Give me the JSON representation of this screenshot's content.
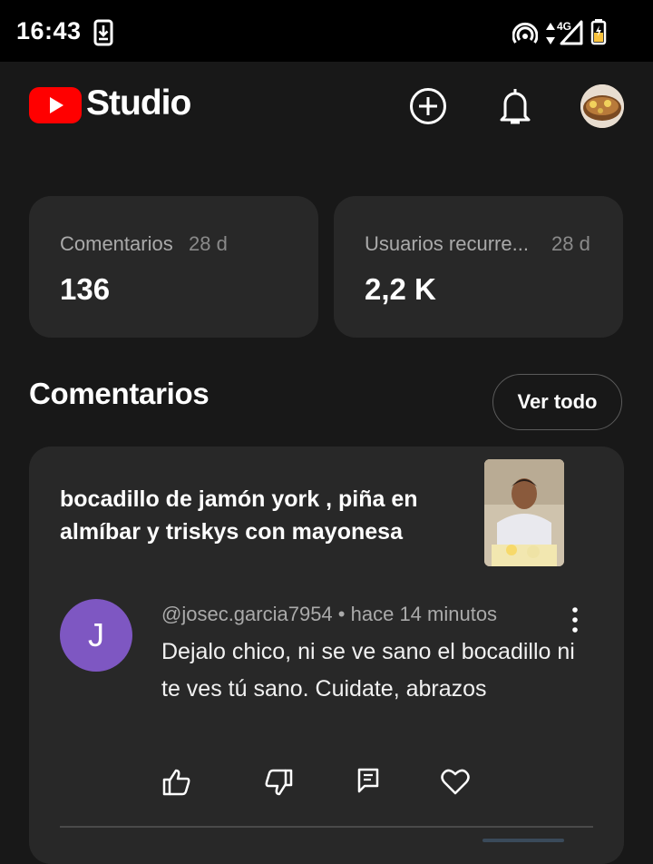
{
  "status_bar": {
    "time": "16:43",
    "network": "4G",
    "icons": [
      "download-icon",
      "hotspot-icon",
      "data-arrows-icon",
      "signal-icon",
      "battery-icon"
    ]
  },
  "header": {
    "app_name": "Studio",
    "brand_color": "#ff0000",
    "icons": [
      "create-icon",
      "bell-icon",
      "avatar"
    ]
  },
  "stats": [
    {
      "label": "Comentarios",
      "period": "28 d",
      "value": "136"
    },
    {
      "label": "Usuarios recurre...",
      "period": "28 d",
      "value": "2,2 K"
    }
  ],
  "comments_section": {
    "title": "Comentarios",
    "view_all_label": "Ver todo"
  },
  "comment": {
    "video_title": "bocadillo de jamón york , piña en almíbar y triskys con mayonesa",
    "avatar_letter": "J",
    "avatar_color": "#7e57c2",
    "author": "@josec.garcia7954",
    "time": "hace 14 minutos",
    "text": "Dejalo chico, ni se ve sano el bocadillo ni te ves tú sano. Cuidate, abrazos",
    "actions": [
      "like-icon",
      "dislike-icon",
      "reply-icon",
      "heart-icon"
    ]
  }
}
